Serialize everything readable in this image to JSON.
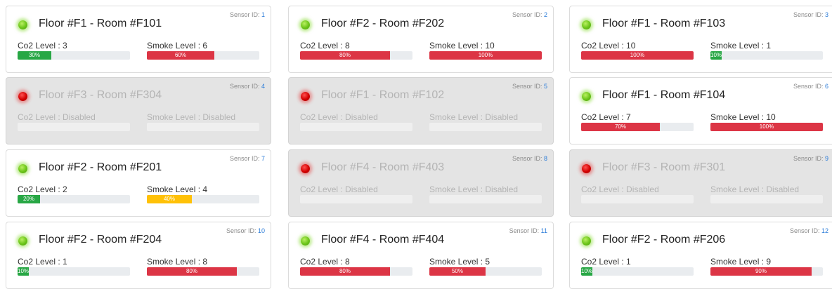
{
  "labels": {
    "sensor_id_prefix": "Sensor ID:",
    "co2_prefix": "Co2 Level : ",
    "smoke_prefix": "Smoke Level : ",
    "disabled": "Disabled"
  },
  "colors": {
    "green": "#28a745",
    "red": "#dc3545",
    "yellow": "#ffc107",
    "led_on": "#6ac418",
    "led_off": "#d20000"
  },
  "sensors": [
    {
      "id": "1",
      "title": "Floor #F1 - Room #F101",
      "status": "on",
      "co2": {
        "level": "3",
        "percent": 30,
        "text": "30%",
        "color": "green"
      },
      "smoke": {
        "level": "6",
        "percent": 60,
        "text": "60%",
        "color": "red"
      }
    },
    {
      "id": "2",
      "title": "Floor #F2 - Room #F202",
      "status": "on",
      "co2": {
        "level": "8",
        "percent": 80,
        "text": "80%",
        "color": "red"
      },
      "smoke": {
        "level": "10",
        "percent": 100,
        "text": "100%",
        "color": "red"
      }
    },
    {
      "id": "3",
      "title": "Floor #F1 - Room #F103",
      "status": "on",
      "co2": {
        "level": "10",
        "percent": 100,
        "text": "100%",
        "color": "red"
      },
      "smoke": {
        "level": "1",
        "percent": 10,
        "text": "10%",
        "color": "green"
      }
    },
    {
      "id": "4",
      "title": "Floor #F3 - Room #F304",
      "status": "off",
      "co2": {
        "level": "Disabled",
        "percent": 0,
        "text": "",
        "color": "green"
      },
      "smoke": {
        "level": "Disabled",
        "percent": 0,
        "text": "",
        "color": "green"
      }
    },
    {
      "id": "5",
      "title": "Floor #F1 - Room #F102",
      "status": "off",
      "co2": {
        "level": "Disabled",
        "percent": 0,
        "text": "",
        "color": "green"
      },
      "smoke": {
        "level": "Disabled",
        "percent": 0,
        "text": "",
        "color": "green"
      }
    },
    {
      "id": "6",
      "title": "Floor #F1 - Room #F104",
      "status": "on",
      "co2": {
        "level": "7",
        "percent": 70,
        "text": "70%",
        "color": "red"
      },
      "smoke": {
        "level": "10",
        "percent": 100,
        "text": "100%",
        "color": "red"
      }
    },
    {
      "id": "7",
      "title": "Floor #F2 - Room #F201",
      "status": "on",
      "co2": {
        "level": "2",
        "percent": 20,
        "text": "20%",
        "color": "green"
      },
      "smoke": {
        "level": "4",
        "percent": 40,
        "text": "40%",
        "color": "yellow"
      }
    },
    {
      "id": "8",
      "title": "Floor #F4 - Room #F403",
      "status": "off",
      "co2": {
        "level": "Disabled",
        "percent": 0,
        "text": "",
        "color": "green"
      },
      "smoke": {
        "level": "Disabled",
        "percent": 0,
        "text": "",
        "color": "green"
      }
    },
    {
      "id": "9",
      "title": "Floor #F3 - Room #F301",
      "status": "off",
      "co2": {
        "level": "Disabled",
        "percent": 0,
        "text": "",
        "color": "green"
      },
      "smoke": {
        "level": "Disabled",
        "percent": 0,
        "text": "",
        "color": "green"
      }
    },
    {
      "id": "10",
      "title": "Floor #F2 - Room #F204",
      "status": "on",
      "co2": {
        "level": "1",
        "percent": 10,
        "text": "10%",
        "color": "green"
      },
      "smoke": {
        "level": "8",
        "percent": 80,
        "text": "80%",
        "color": "red"
      }
    },
    {
      "id": "11",
      "title": "Floor #F4 - Room #F404",
      "status": "on",
      "co2": {
        "level": "8",
        "percent": 80,
        "text": "80%",
        "color": "red"
      },
      "smoke": {
        "level": "5",
        "percent": 50,
        "text": "50%",
        "color": "red"
      }
    },
    {
      "id": "12",
      "title": "Floor #F2 - Room #F206",
      "status": "on",
      "co2": {
        "level": "1",
        "percent": 10,
        "text": "10%",
        "color": "green"
      },
      "smoke": {
        "level": "9",
        "percent": 90,
        "text": "90%",
        "color": "red"
      }
    }
  ]
}
